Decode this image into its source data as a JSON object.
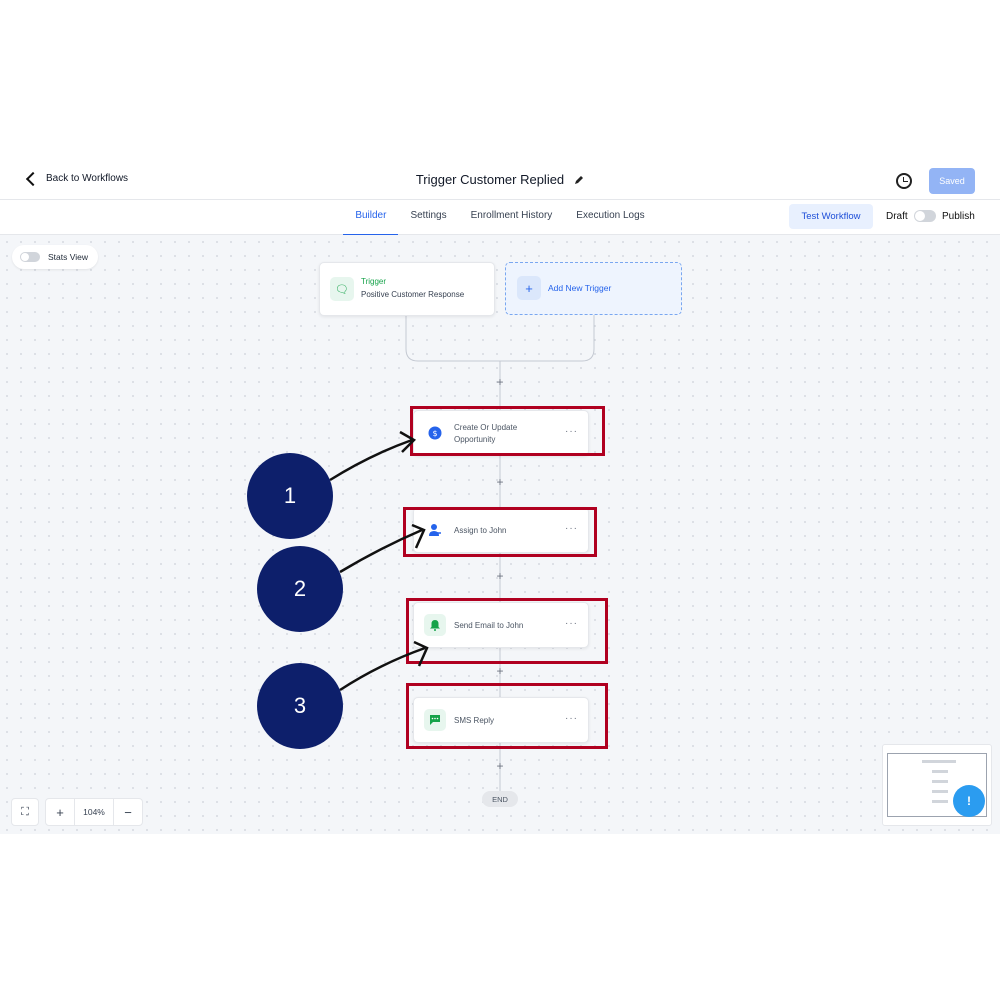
{
  "header": {
    "back_label": "Back to Workflows",
    "title": "Trigger Customer Replied",
    "saved_label": "Saved"
  },
  "tabs": [
    {
      "label": "Builder",
      "active": true
    },
    {
      "label": "Settings",
      "active": false
    },
    {
      "label": "Enrollment History",
      "active": false
    },
    {
      "label": "Execution Logs",
      "active": false
    }
  ],
  "actions": {
    "test_workflow_label": "Test Workflow",
    "draft_label": "Draft",
    "publish_label": "Publish"
  },
  "canvas": {
    "stats_view_label": "Stats View",
    "trigger": {
      "label": "Trigger",
      "name": "Positive Customer Response"
    },
    "add_trigger_label": "Add New Trigger",
    "steps": [
      {
        "line1": "Create Or Update",
        "line2": "Opportunity",
        "icon": "dollar-icon",
        "color": "#2563eb"
      },
      {
        "line1": "Assign to John",
        "line2": "",
        "icon": "user-assign-icon",
        "color": "#2563eb"
      },
      {
        "line1": "Send Email to John",
        "line2": "",
        "icon": "bell-icon",
        "color": "#16a34a"
      },
      {
        "line1": "SMS Reply",
        "line2": "",
        "icon": "chat-icon",
        "color": "#16a34a"
      }
    ],
    "end_label": "END",
    "zoom_level": "104%"
  },
  "annotations": {
    "badges": [
      "1",
      "2",
      "3"
    ],
    "box_color": "#b00020",
    "badge_color": "#0d1f6b"
  }
}
